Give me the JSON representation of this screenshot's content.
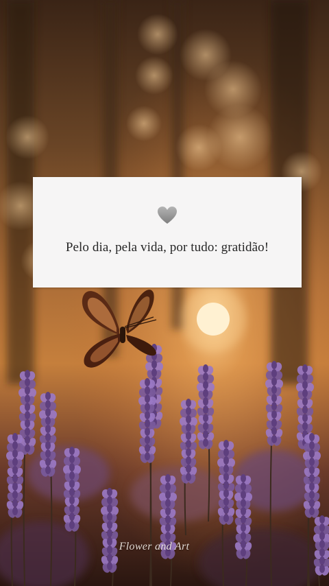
{
  "card": {
    "icon": "grey-heart-icon",
    "quote": "Pelo dia, pela vida, por tudo: gratidão!"
  },
  "watermark": {
    "text": "Flower and Art"
  },
  "colors": {
    "card_background": "#f6f5f5",
    "quote_text": "#262626",
    "heart": "#9a9a9a",
    "sunset_glow": "#f3c27a",
    "lavender": "#8f6bb8"
  }
}
